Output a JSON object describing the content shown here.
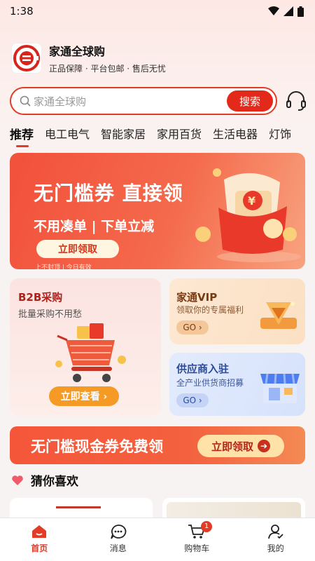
{
  "status_bar": {
    "time": "1:38"
  },
  "brand": {
    "name": "家通全球购",
    "slogan": "正品保障 · 平台包邮 · 售后无忧"
  },
  "search": {
    "placeholder": "家通全球购",
    "button_label": "搜索"
  },
  "categories": [
    {
      "label": "推荐",
      "active": true
    },
    {
      "label": "电工电气"
    },
    {
      "label": "智能家居"
    },
    {
      "label": "家用百货"
    },
    {
      "label": "生活电器"
    },
    {
      "label": "灯饰"
    }
  ],
  "banner_coupon": {
    "title": "无门槛券 直接领",
    "subtitle": "不用凑单 | 下单立减",
    "button_label": "立即领取",
    "note": "上不封顶 | 今日有效",
    "coupon_symbol": "¥"
  },
  "b2b": {
    "title": "B2B采购",
    "subtitle": "批量采购不用愁",
    "button_label": "立即查看 ›"
  },
  "vip": {
    "title": "家通VIP",
    "subtitle": "领取你的专属福利",
    "button_label": "GO ›"
  },
  "supplier": {
    "title": "供应商入驻",
    "subtitle": "全产业供货商招募",
    "button_label": "GO ›"
  },
  "banner_cash": {
    "title": "无门槛现金券免费领",
    "button_label": "立即领取",
    "arrow": "➔"
  },
  "guess_like": {
    "title": "猜你喜欢"
  },
  "tabbar": {
    "items": [
      {
        "label": "首页",
        "active": true
      },
      {
        "label": "消息"
      },
      {
        "label": "购物车",
        "badge": "1"
      },
      {
        "label": "我的"
      }
    ]
  },
  "colors": {
    "accent": "#e23b26",
    "orange": "#f59a24",
    "vip_brown": "#7a3a14",
    "supplier_blue": "#2c4b9a"
  }
}
